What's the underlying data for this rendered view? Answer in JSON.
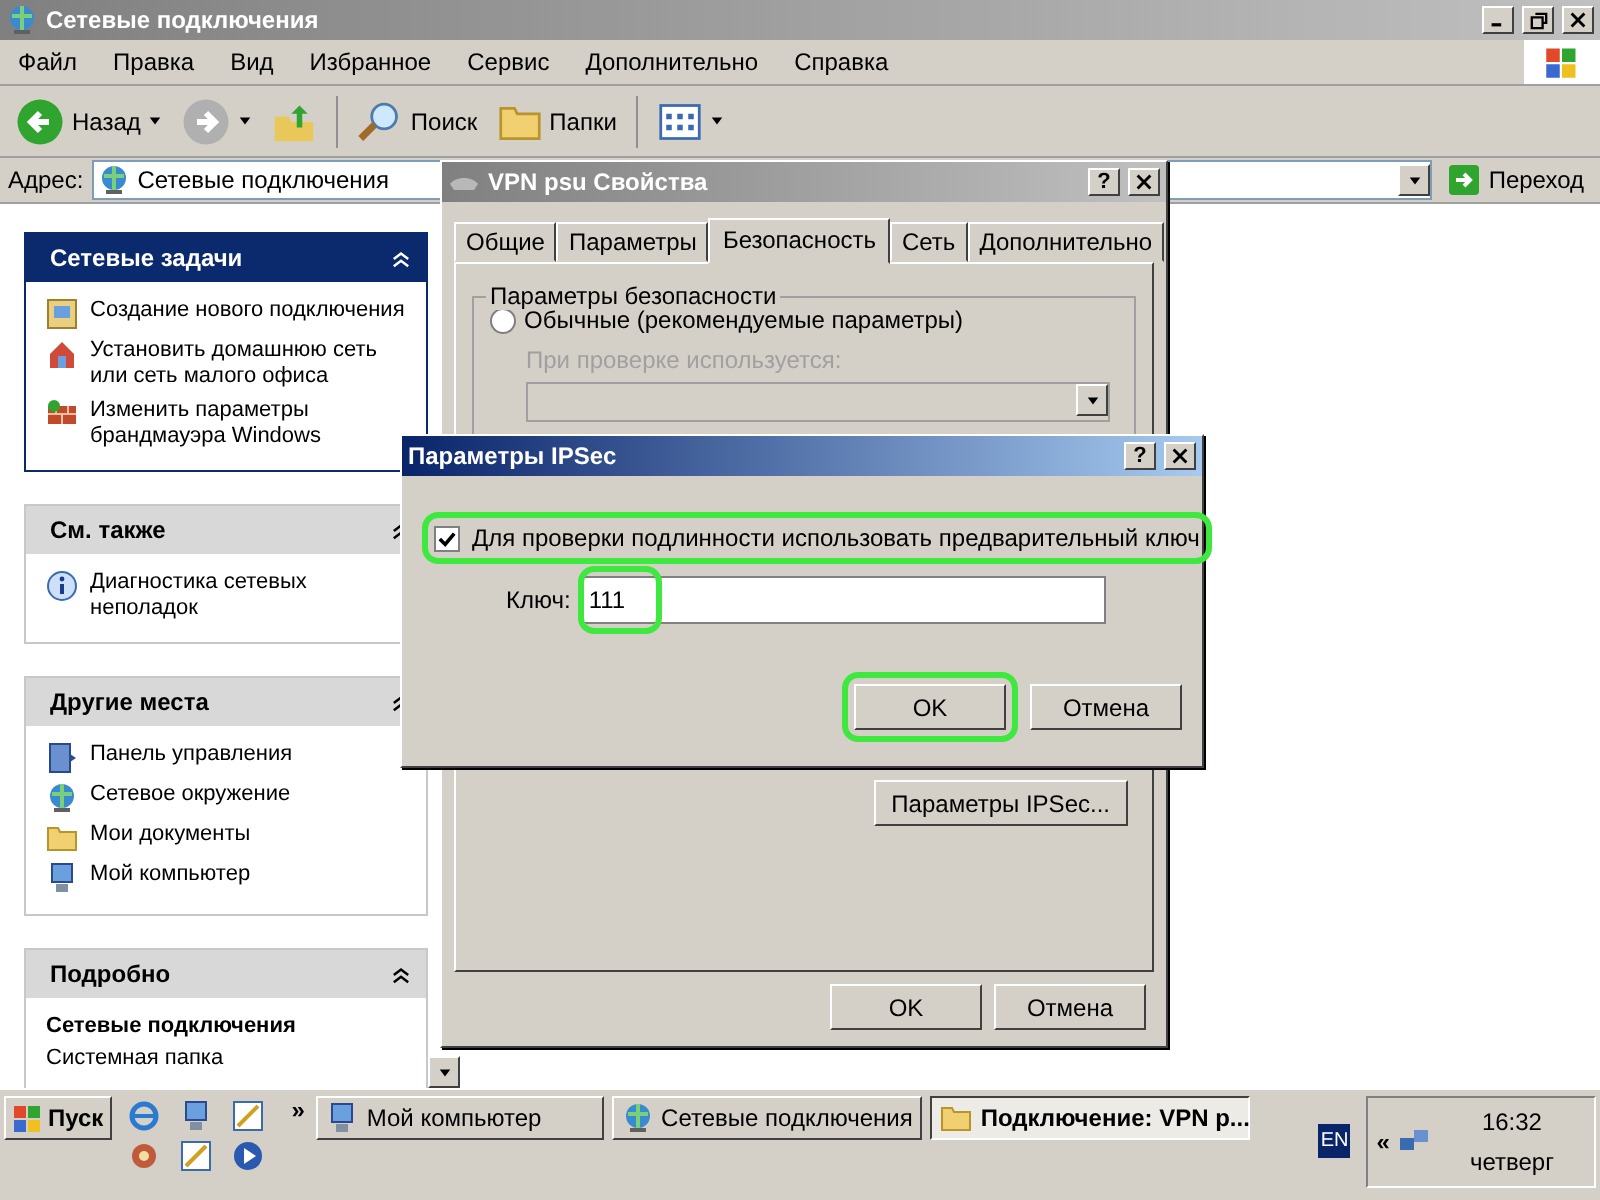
{
  "window": {
    "title": "Сетевые подключения"
  },
  "menu": [
    "Файл",
    "Правка",
    "Вид",
    "Избранное",
    "Сервис",
    "Дополнительно",
    "Справка"
  ],
  "toolbar": [
    {
      "kind": "back",
      "label": "Назад",
      "dropdown": true
    },
    {
      "kind": "forward",
      "dropdown": true
    },
    {
      "kind": "up"
    },
    {
      "kind": "search",
      "label": "Поиск"
    },
    {
      "kind": "folders",
      "label": "Папки"
    },
    {
      "kind": "views",
      "dropdown": true
    }
  ],
  "address": {
    "label": "Адрес:",
    "value": "Сетевые подключения",
    "go": "Переход"
  },
  "panels": [
    {
      "kind": "primary",
      "title": "Сетевые задачи",
      "items": [
        {
          "label": "Создание нового подключения"
        },
        {
          "label": "Установить домашнюю сеть или сеть малого офиса"
        },
        {
          "label": "Изменить параметры брандмауэра Windows"
        }
      ]
    },
    {
      "kind": "secondary",
      "title": "См. также",
      "items": [
        {
          "label": "Диагностика сетевых неполадок"
        }
      ]
    },
    {
      "kind": "secondary",
      "title": "Другие места",
      "items": [
        {
          "label": "Панель управления"
        },
        {
          "label": "Сетевое окружение"
        },
        {
          "label": "Мои документы"
        },
        {
          "label": "Мой компьютер"
        }
      ]
    },
    {
      "kind": "details",
      "title": "Подробно",
      "name": "Сетевые подключения",
      "type": "Системная папка"
    }
  ],
  "properties_dialog": {
    "title": "VPN psu Свойства",
    "help": "?",
    "tabs": [
      {
        "label": "Общие",
        "selected": false
      },
      {
        "label": "Параметры",
        "selected": false
      },
      {
        "label": "Безопасность",
        "selected": true
      },
      {
        "label": "Сеть",
        "selected": false
      },
      {
        "label": "Дополнительно",
        "selected": false
      }
    ],
    "group_title": "Параметры безопасности",
    "radio": {
      "label": "Обычные (рекомендуемые параметры)",
      "selected": false
    },
    "hint": "При проверке используется:",
    "ipsec_button": "Параметры IPSec...",
    "buttons": [
      "OK",
      "Отмена"
    ]
  },
  "ipsec_dialog": {
    "title": "Параметры IPSec",
    "help": "?",
    "checkbox": {
      "label": "Для проверки подлинности использовать предварительный ключ",
      "checked": true,
      "highlighted": true
    },
    "key": {
      "label": "Ключ:",
      "value": "111",
      "highlighted": true
    },
    "buttons": [
      {
        "label": "OK",
        "highlighted": true
      },
      {
        "label": "Отмена",
        "highlighted": false
      }
    ]
  },
  "taskbar": {
    "start": "Пуск",
    "more": "»",
    "tasks": [
      {
        "label": "Мой компьютер",
        "selected": false
      },
      {
        "label": "Сетевые подключения",
        "selected": false
      },
      {
        "label": "Подключение: VPN p...",
        "selected": true
      }
    ],
    "language": "EN",
    "tray_more": "«",
    "time": "16:32",
    "day": "четверг"
  }
}
